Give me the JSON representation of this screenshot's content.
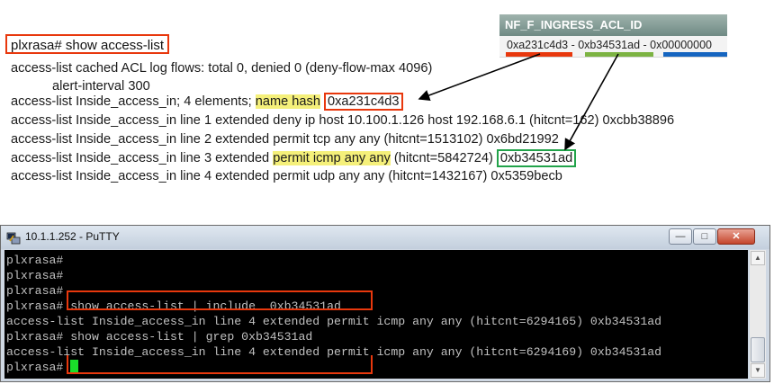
{
  "document": {
    "command": "plxrasa# show access-list",
    "lines": {
      "l1": "access-list cached ACL log flows: total 0, denied 0 (deny-flow-max 4096)",
      "l2": "alert-interval 300",
      "l3_prefix": "access-list Inside_access_in; 4 elements; ",
      "l3_hl": "name hash",
      "l3_hash": "0xa231c4d3",
      "l4": "access-list Inside_access_in line 1 extended deny ip host 10.100.1.126 host 192.168.6.1 (hitcnt=162) 0xcbb38896",
      "l5": "access-list Inside_access_in line 2 extended permit tcp any any (hitcnt=1513102) 0x6bd21992",
      "l6_prefix": "access-list Inside_access_in line 3 extended ",
      "l6_hl": "permit icmp any any",
      "l6_mid": " (hitcnt=5842724) ",
      "l6_hash": "0xb34531ad",
      "l7": "access-list Inside_access_in line 4 extended permit udp any any (hitcnt=1432167) 0x5359becb"
    }
  },
  "nf_table": {
    "header": "NF_F_INGRESS_ACL_ID",
    "value": "0xa231c4d3 - 0xb34531ad - 0x00000000",
    "bar_colors": [
      "#e8380d",
      "#7cb342",
      "#1565c0"
    ]
  },
  "putty": {
    "title": "10.1.1.252 - PuTTY",
    "minimize": "—",
    "maximize": "□",
    "close": "✕",
    "lines": [
      "plxrasa#",
      "plxrasa#",
      "plxrasa#",
      "plxrasa# show access-list | include  0xb34531ad",
      "access-list Inside_access_in line 4 extended permit icmp any any (hitcnt=6294165) 0xb34531ad",
      "plxrasa# show access-list | grep 0xb34531ad",
      "access-list Inside_access_in line 4 extended permit icmp any any (hitcnt=6294169) 0xb34531ad",
      "plxrasa# "
    ]
  },
  "colors": {
    "highlight_box": "#e8380d",
    "match_box": "#22a34a",
    "text_highlight": "#f5f07a",
    "cursor": "#1adf2a"
  }
}
